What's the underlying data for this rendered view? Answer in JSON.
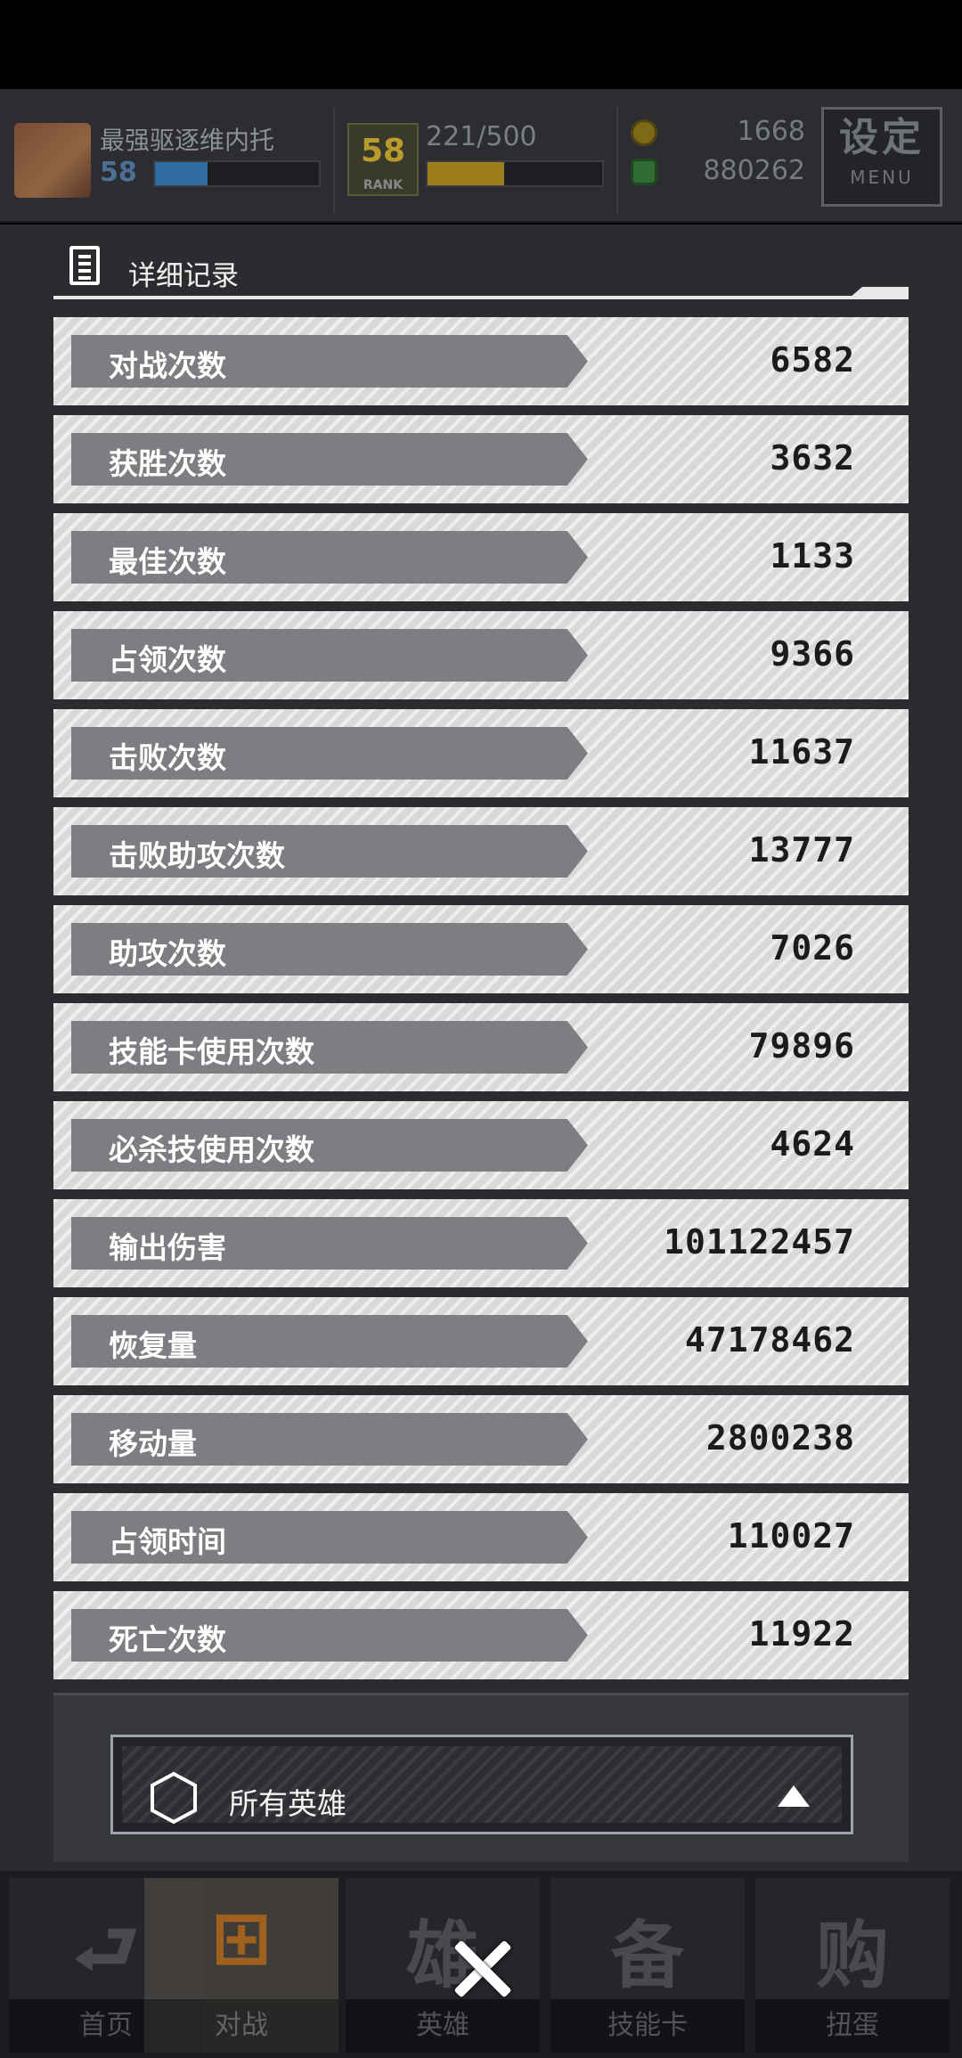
{
  "header": {
    "player_name": "最强驱逐维内托",
    "level": "58",
    "level_progress": 0.32,
    "rank_badge_text": "58",
    "rank_badge_sub": "RANK",
    "rank_progress_text": "221/500",
    "rank_progress": 0.44,
    "currency_gold": "1668",
    "currency_green": "880262",
    "menu_title": "设定",
    "menu_sub": "MENU"
  },
  "panel": {
    "title": "详细记录",
    "stats": [
      {
        "label": "对战次数",
        "value": "6582"
      },
      {
        "label": "获胜次数",
        "value": "3632"
      },
      {
        "label": "最佳次数",
        "value": "1133"
      },
      {
        "label": "占领次数",
        "value": "9366"
      },
      {
        "label": "击败次数",
        "value": "11637"
      },
      {
        "label": "击败助攻次数",
        "value": "13777"
      },
      {
        "label": "助攻次数",
        "value": "7026"
      },
      {
        "label": "技能卡使用次数",
        "value": "79896"
      },
      {
        "label": "必杀技使用次数",
        "value": "4624"
      },
      {
        "label": "输出伤害",
        "value": "101122457"
      },
      {
        "label": "恢复量",
        "value": "47178462"
      },
      {
        "label": "移动量",
        "value": "2800238"
      },
      {
        "label": "占领时间",
        "value": "110027"
      },
      {
        "label": "死亡次数",
        "value": "11922"
      }
    ]
  },
  "filter": {
    "selected": "所有英雄"
  },
  "nav": [
    {
      "label": "首页",
      "glyph": "⮐",
      "icon": "home-icon"
    },
    {
      "label": "对战",
      "glyph": "⊞",
      "icon": "gamepad-icon"
    },
    {
      "label": "英雄",
      "glyph": "雄",
      "icon": "hero-icon"
    },
    {
      "label": "技能卡",
      "glyph": "备",
      "icon": "skill-card-icon"
    },
    {
      "label": "扭蛋",
      "glyph": "购",
      "icon": "gacha-icon"
    }
  ],
  "colors": {
    "accent_blue": "#2f6aa3",
    "accent_gold": "#9c7f1c",
    "active_nav": "#c1721f"
  }
}
